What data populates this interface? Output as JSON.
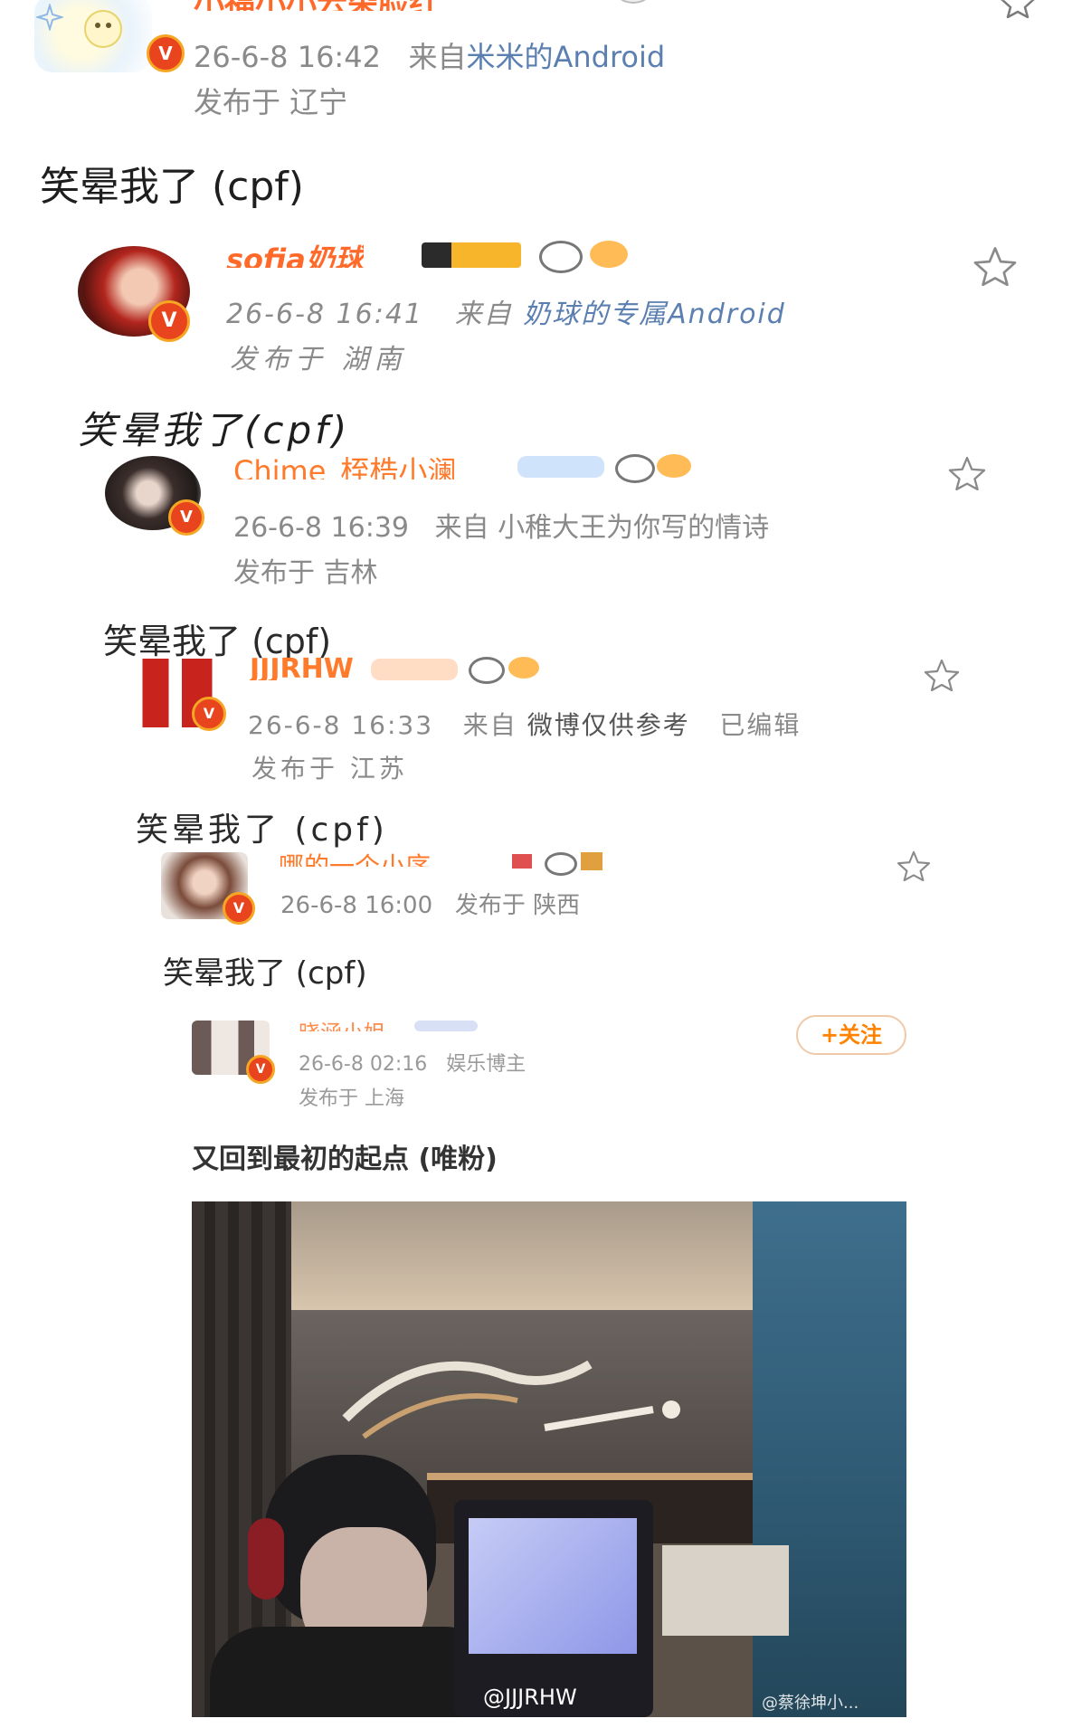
{
  "level0": {
    "name": "小福小小云朵脸红",
    "time": "26-6-8 16:42",
    "source_prefix": "来自",
    "source": "米米的Android",
    "location": "发布于 辽宁",
    "text": "笑晕我了 (cpf)"
  },
  "level1": {
    "name": "sofia奶球",
    "time": "26-6-8 16:41",
    "source_prefix": "来自",
    "source": "奶球的专属Android",
    "location": "发布于 湖南",
    "text": "笑晕我了(cpf)"
  },
  "level2": {
    "name": "Chime_桎梏小澜",
    "time": "26-6-8 16:39",
    "source_prefix": "来自",
    "source": "小稚大王为你写的情诗",
    "location": "发布于 吉林",
    "text": "笑晕我了 (cpf)"
  },
  "level3": {
    "name": "JJJRHW",
    "time": "26-6-8 16:33",
    "source_prefix": "来自",
    "source": "微博仅供参考",
    "edited": "已编辑",
    "location": "发布于 江苏",
    "text": "笑晕我了 (cpf)"
  },
  "level4": {
    "name": "哪的一个小序",
    "time": "26-6-8 16:00",
    "location": "发布于 陕西",
    "text": "笑晕我了 (cpf)"
  },
  "level5": {
    "name": "晓涵小姐",
    "time": "26-6-8 02:16",
    "tag": "娱乐博主",
    "location": "发布于 上海",
    "follow": "+关注",
    "text": "又回到最初的起点 (唯粉)"
  },
  "video": {
    "watermark_left": "@JJJRHW",
    "watermark_right": "@蔡徐坤小..."
  },
  "colors": {
    "verified": "#f6a623",
    "source_link": "#5b7fb0",
    "follow": "#ff8200",
    "meta": "#8a8a8a"
  },
  "icons": [
    "star-icon",
    "verified-icon",
    "panda-icon",
    "crown-icon",
    "level-badge-icon"
  ]
}
